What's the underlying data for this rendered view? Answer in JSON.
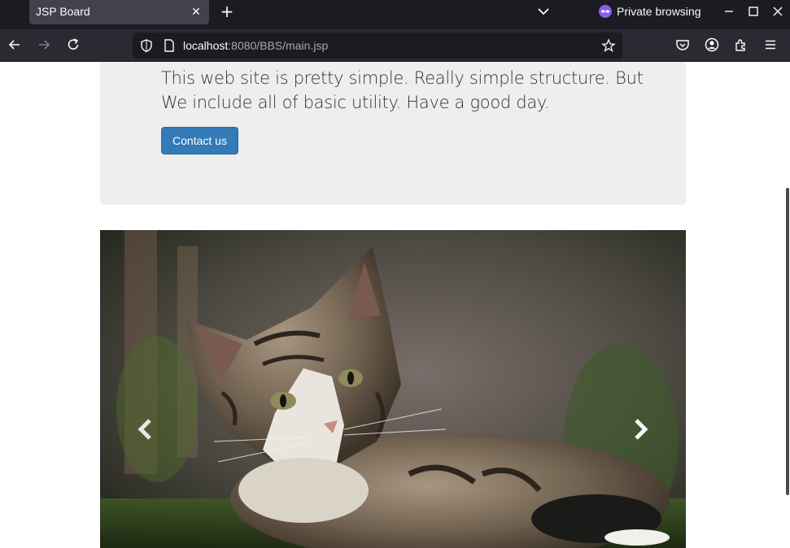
{
  "browser": {
    "tab_title": "JSP Board",
    "private_label": "Private browsing",
    "url_host": "localhost",
    "url_rest": ":8080/BBS/main.jsp"
  },
  "jumbotron": {
    "text": "This web site is pretty simple. Really simple structure. But We include all of basic utility. Have a good day.",
    "button_label": "Contact us"
  },
  "carousel": {
    "image": "tabby-cat-photo",
    "prev_icon": "chevron-left-icon",
    "next_icon": "chevron-right-icon"
  },
  "colors": {
    "chrome_dark": "#1c1b22",
    "chrome_toolbar": "#2b2a33",
    "primary_button": "#337ab7",
    "jumbotron_bg": "#eeeeee",
    "private_accent": "#8a5cf6"
  }
}
